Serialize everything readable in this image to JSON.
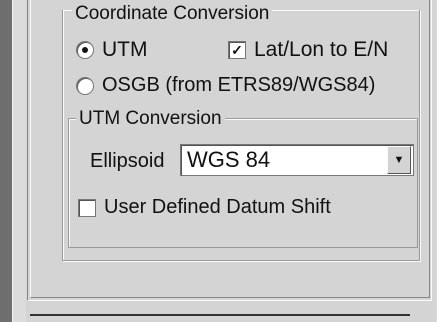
{
  "coordinate_conversion": {
    "legend": "Coordinate Conversion",
    "utm_label": "UTM",
    "latlon_label": "Lat/Lon to E/N",
    "osgb_label": "OSGB (from ETRS89/WGS84)"
  },
  "utm_conversion": {
    "legend": "UTM Conversion",
    "ellipsoid_label": "Ellipsoid",
    "ellipsoid_value": "WGS 84",
    "datum_label": "User Defined Datum Shift"
  },
  "icons": {
    "dropdown": "chevron-down-icon",
    "check": "check-icon"
  }
}
